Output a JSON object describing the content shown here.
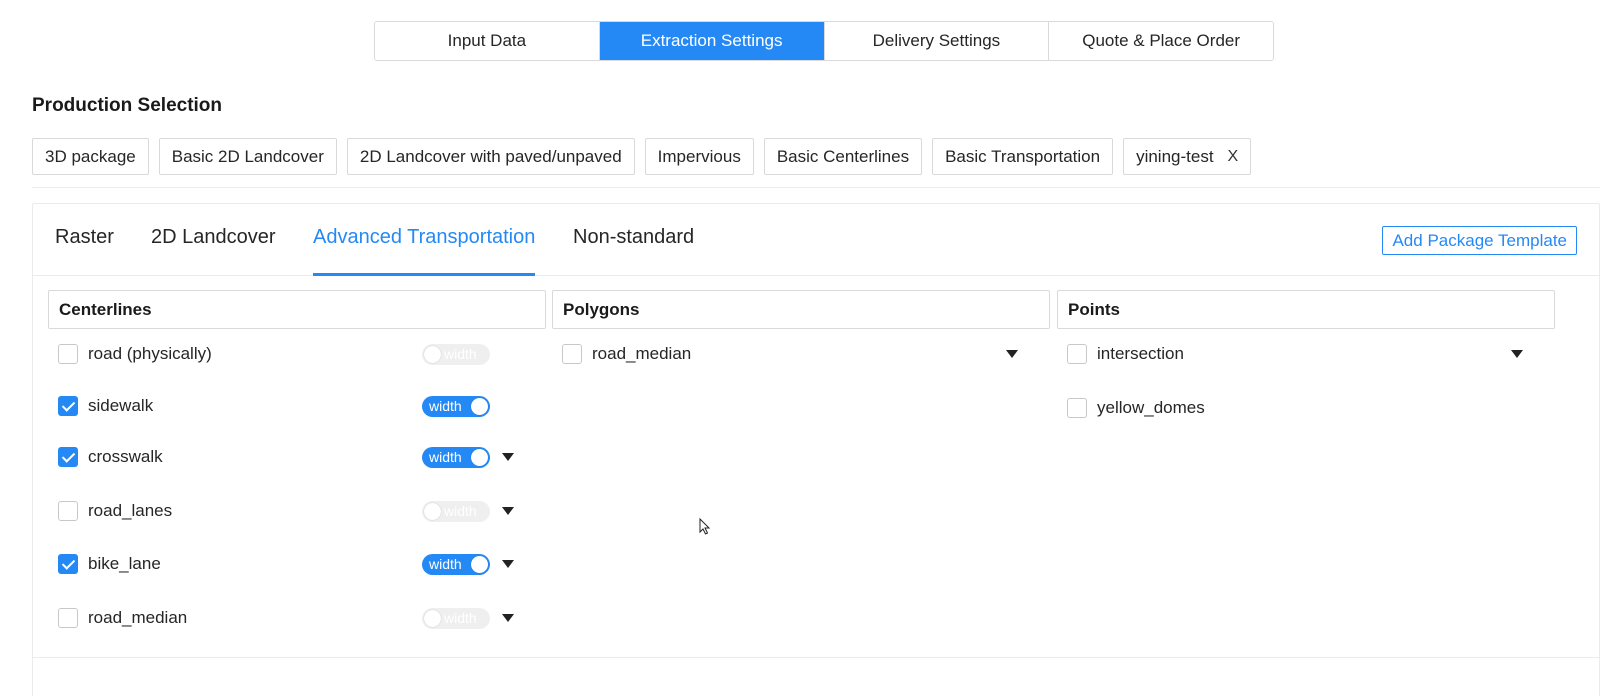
{
  "steps": [
    {
      "label": "Input Data"
    },
    {
      "label": "Extraction Settings"
    },
    {
      "label": "Delivery Settings"
    },
    {
      "label": "Quote & Place Order"
    }
  ],
  "active_step": "Extraction Settings",
  "production_selection": {
    "title": "Production Selection",
    "chips": [
      {
        "label": "3D package"
      },
      {
        "label": "Basic 2D Landcover"
      },
      {
        "label": "2D Landcover with paved/unpaved"
      },
      {
        "label": "Impervious"
      },
      {
        "label": "Basic Centerlines"
      },
      {
        "label": "Basic Transportation"
      },
      {
        "label": "yining-test",
        "close_icon": "X"
      }
    ]
  },
  "tabs": [
    {
      "label": "Raster"
    },
    {
      "label": "2D Landcover"
    },
    {
      "label": "Advanced Transportation"
    },
    {
      "label": "Non-standard"
    }
  ],
  "active_tab": "Advanced Transportation",
  "add_template_label": "Add Package Template",
  "toggle_label": "width",
  "columns": {
    "centerlines": {
      "title": "Centerlines",
      "items": [
        {
          "label": "road (physically)",
          "checked": false,
          "width_on": false,
          "dropdown": false
        },
        {
          "label": "sidewalk",
          "checked": true,
          "width_on": true,
          "dropdown": false
        },
        {
          "label": "crosswalk",
          "checked": true,
          "width_on": true,
          "dropdown": true
        },
        {
          "label": "road_lanes",
          "checked": false,
          "width_on": false,
          "dropdown": true
        },
        {
          "label": "bike_lane",
          "checked": true,
          "width_on": true,
          "dropdown": true
        },
        {
          "label": "road_median",
          "checked": false,
          "width_on": false,
          "dropdown": true
        }
      ]
    },
    "polygons": {
      "title": "Polygons",
      "items": [
        {
          "label": "road_median",
          "checked": false,
          "dropdown": true
        }
      ]
    },
    "points": {
      "title": "Points",
      "items": [
        {
          "label": "intersection",
          "checked": false,
          "dropdown": true
        },
        {
          "label": "yellow_domes",
          "checked": false,
          "dropdown": false
        }
      ]
    }
  },
  "colors": {
    "accent": "#2589f5",
    "border": "#d9d9d9"
  }
}
